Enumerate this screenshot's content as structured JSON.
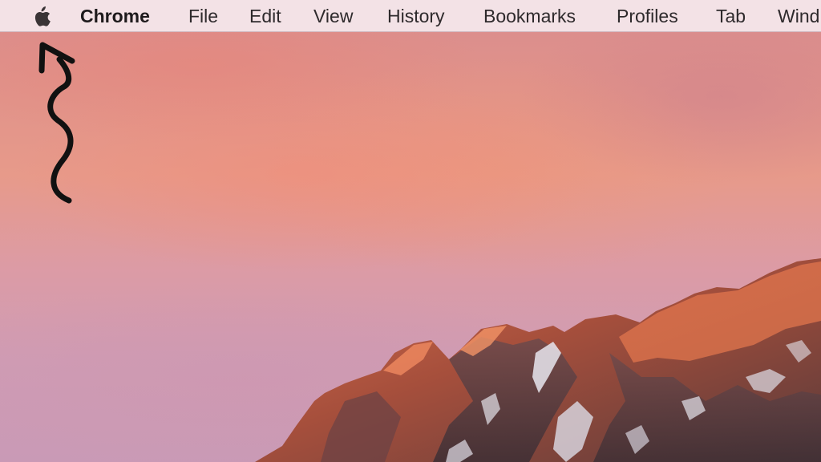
{
  "menubar": {
    "apple_icon": "apple-logo-icon",
    "app_name": "Chrome",
    "items": [
      "File",
      "Edit",
      "View",
      "History",
      "Bookmarks",
      "Profiles",
      "Tab",
      "Wind"
    ]
  },
  "annotation": {
    "icon": "hand-drawn-arrow-icon",
    "color": "#111111"
  },
  "wallpaper": {
    "name": "macOS Sierra",
    "sky_color": "#e0928a",
    "mountain_color": "#b85a3e"
  }
}
